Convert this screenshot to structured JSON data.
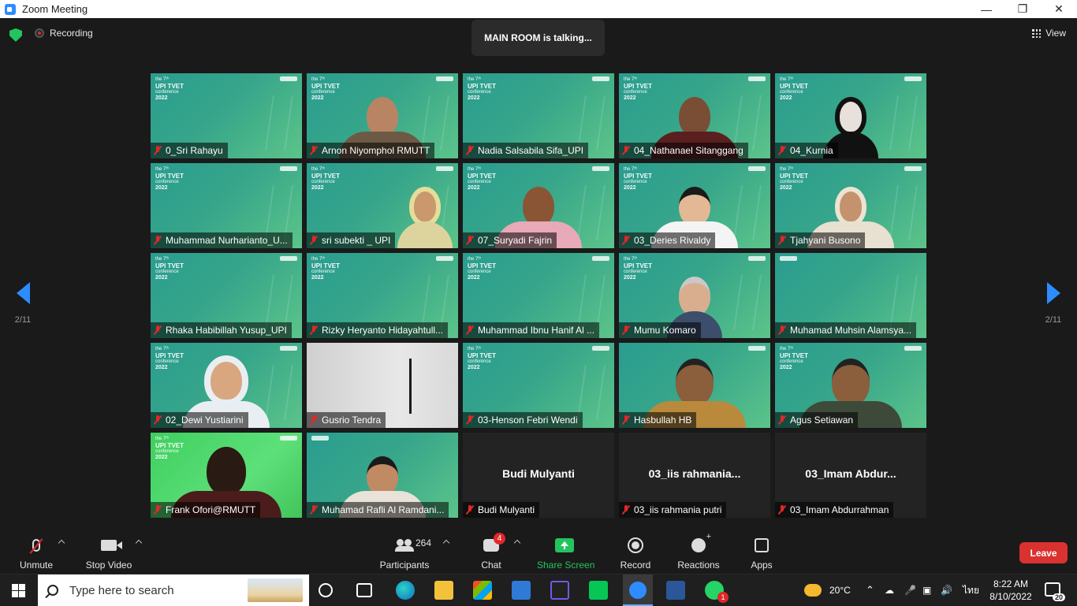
{
  "window": {
    "title": "Zoom Meeting"
  },
  "meeting": {
    "recording_label": "Recording",
    "talking_text": "MAIN ROOM is talking...",
    "view_label": "View",
    "page_left": "2/11",
    "page_right": "2/11"
  },
  "tile_background_text": {
    "edition": "the 7ᵗʰ",
    "name": "UPI TVET",
    "sub": "conference",
    "year": "2022"
  },
  "participants": [
    "0_Sri Rahayu",
    "Arnon Niyomphol RMUTT",
    "Nadia Salsabila Sifa_UPI",
    "04_Nathanael Sitanggang",
    "04_Kurnia",
    "Muhammad Nurharianto_U...",
    "sri subekti _ UPI",
    "07_Suryadi Fajrin",
    "03_Deries Rivaldy",
    "Tjahyani Busono",
    "Rhaka Habibillah Yusup_UPI",
    "Rizky Heryanto Hidayahtull...",
    "Muhammad Ibnu Hanif Al ...",
    "Mumu Komaro",
    "Muhamad Muhsin Alamsya...",
    "02_Dewi Yustiarini",
    "Gusrio Tendra",
    "03-Henson Febri Wendi",
    "Hasbullah HB",
    "Agus Setiawan",
    "Frank Ofori@RMUTT",
    "Muhamad Rafli Al Ramdani...",
    "Budi Mulyanti",
    "03_iis rahmania putri",
    "03_Imam Abdurrahman"
  ],
  "video_off_names": {
    "budi": "Budi Mulyanti",
    "iis": "03_iis  rahmania...",
    "imam": "03_Imam  Abdur..."
  },
  "toolbar": {
    "unmute": "Unmute",
    "stop_video": "Stop Video",
    "participants": "Participants",
    "participants_count": "264",
    "chat": "Chat",
    "chat_badge": "4",
    "share": "Share Screen",
    "record": "Record",
    "reactions": "Reactions",
    "apps": "Apps",
    "leave": "Leave"
  },
  "taskbar": {
    "search_placeholder": "Type here to search",
    "temperature": "20°C",
    "language": "ไทย",
    "time": "8:22 AM",
    "date": "8/10/2022",
    "notifications": "20",
    "whatsapp_badge": "1"
  },
  "colors": {
    "accent": "#2d8cff",
    "leave": "#d9322f",
    "share": "#23c45e",
    "muted": "#e02828"
  }
}
